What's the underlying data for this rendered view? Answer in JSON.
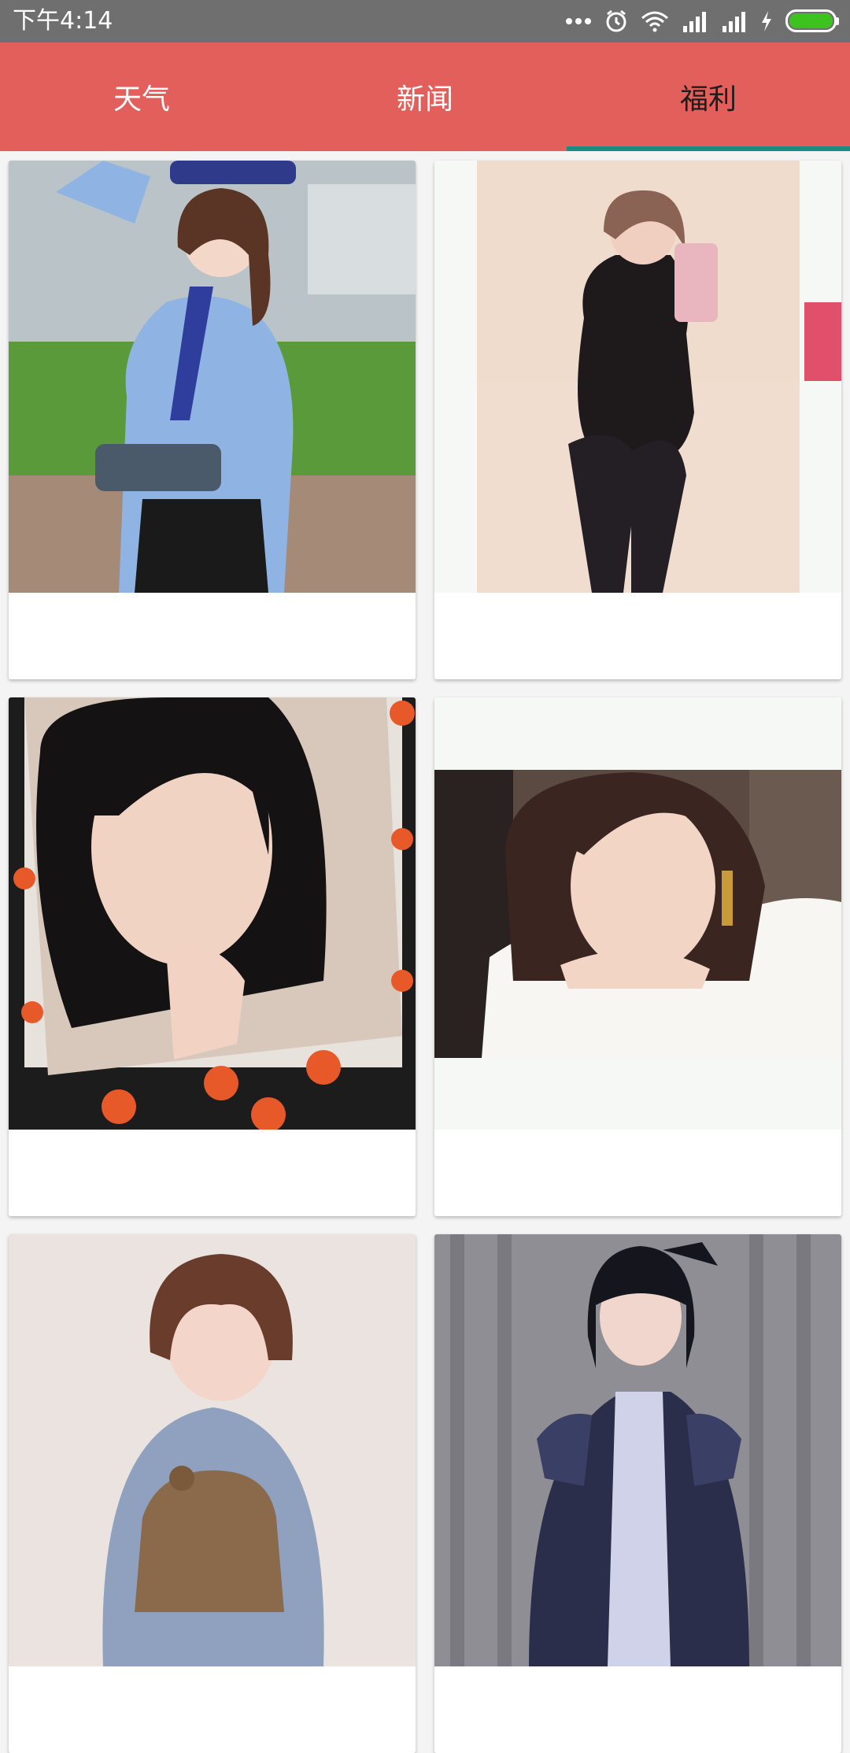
{
  "status_bar": {
    "time": "下午4:14",
    "icons": [
      "more-dots-icon",
      "alarm-icon",
      "wifi-icon",
      "signal-icon",
      "signal-icon",
      "charging-icon",
      "battery-icon"
    ],
    "battery_color": "#3ec21f"
  },
  "tabs": [
    {
      "label": "天气",
      "active": false
    },
    {
      "label": "新闻",
      "active": false
    },
    {
      "label": "福利",
      "active": true
    }
  ],
  "colors": {
    "tab_bar": "#e25f5c",
    "indicator": "#1c8c80",
    "active_tab_text": "#1d1d1d",
    "inactive_tab_text": "#ffffff"
  },
  "gallery": {
    "cards": [
      {
        "image": "photo-cosplay-police-girl",
        "caption": ""
      },
      {
        "image": "photo-girl-mirror-selfie",
        "caption": ""
      },
      {
        "image": "photo-girl-pumpkin-frame",
        "caption": ""
      },
      {
        "image": "photo-girl-resting-on-hands",
        "caption": ""
      },
      {
        "image": "photo-girl-holding-cat",
        "caption": ""
      },
      {
        "image": "photo-girl-lolita-dress",
        "caption": ""
      }
    ]
  }
}
